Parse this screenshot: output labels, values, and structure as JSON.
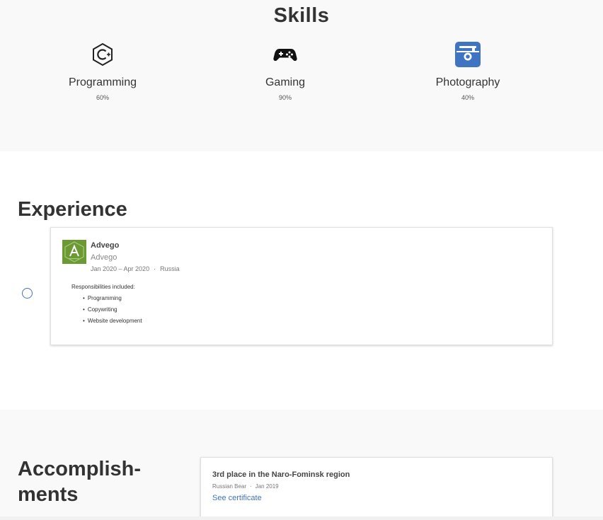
{
  "skills": {
    "title": "Skills",
    "items": [
      {
        "name": "Programming",
        "percent": "60%",
        "icon": "c-language-icon"
      },
      {
        "name": "Gaming",
        "percent": "90%",
        "icon": "gamepad-icon"
      },
      {
        "name": "Photography",
        "percent": "40%",
        "icon": "camera-icon"
      }
    ]
  },
  "experience": {
    "title": "Experience",
    "jobs": [
      {
        "company": "Advego",
        "organization": "Advego",
        "dates": "Jan 2020 – Apr 2020",
        "separator": "·",
        "location": "Russia",
        "responsibilities_label": "Responsibilities included:",
        "responsibilities": [
          "Programming",
          "Copywriting",
          "Website development"
        ]
      }
    ]
  },
  "accomplishments": {
    "title": "Accomplish-\nments",
    "items": [
      {
        "title": "3rd place in the Naro-Fominsk region",
        "issuer": "Russian Bear",
        "separator": "·",
        "date": "Jan 2019",
        "link_label": "See certificate"
      }
    ]
  },
  "colors": {
    "accent": "#3f74c2",
    "logo_green": "#6b9a35",
    "section_bg": "#f9f9f9"
  }
}
